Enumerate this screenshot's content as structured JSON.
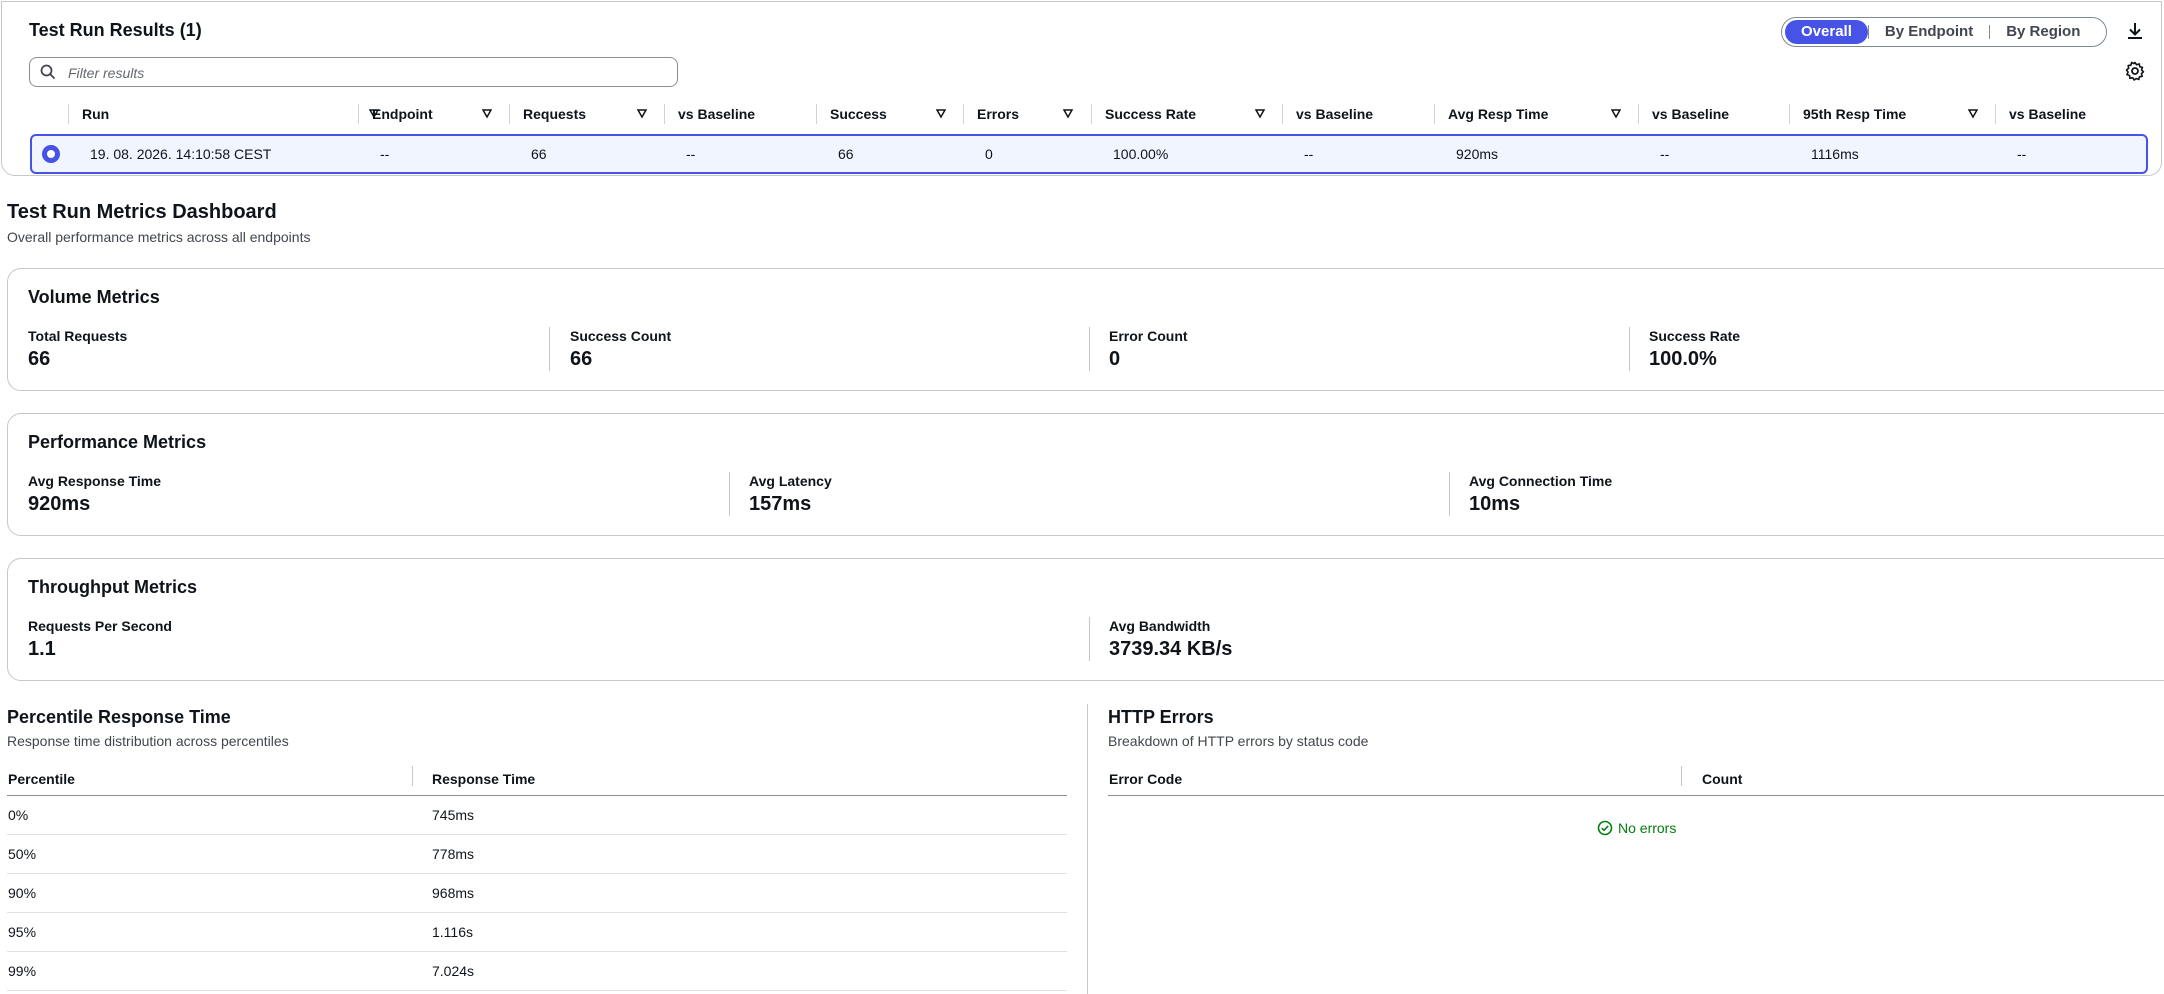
{
  "results": {
    "title": "Test Run Results (1)",
    "filter_placeholder": "Filter results",
    "tabs": [
      {
        "label": "Overall",
        "active": true
      },
      {
        "label": "By Endpoint",
        "active": false
      },
      {
        "label": "By Region",
        "active": false
      }
    ],
    "columns": [
      "Run",
      "Endpoint",
      "Requests",
      "vs Baseline",
      "Success",
      "Errors",
      "Success Rate",
      "vs Baseline",
      "Avg Resp Time",
      "vs Baseline",
      "95th Resp Time",
      "vs Baseline"
    ],
    "row": [
      "19. 08. 2026. 14:10:58 CEST",
      "--",
      "66",
      "--",
      "66",
      "0",
      "100.00%",
      "--",
      "920ms",
      "--",
      "1116ms",
      "--"
    ]
  },
  "dashboard": {
    "title": "Test Run Metrics Dashboard",
    "subtitle": "Overall performance metrics across all endpoints"
  },
  "volume": {
    "title": "Volume Metrics",
    "metrics": [
      {
        "label": "Total Requests",
        "value": "66"
      },
      {
        "label": "Success Count",
        "value": "66"
      },
      {
        "label": "Error Count",
        "value": "0"
      },
      {
        "label": "Success Rate",
        "value": "100.0%"
      }
    ]
  },
  "performance": {
    "title": "Performance Metrics",
    "metrics": [
      {
        "label": "Avg Response Time",
        "value": "920ms"
      },
      {
        "label": "Avg Latency",
        "value": "157ms"
      },
      {
        "label": "Avg Connection Time",
        "value": "10ms"
      }
    ]
  },
  "throughput": {
    "title": "Throughput Metrics",
    "metrics": [
      {
        "label": "Requests Per Second",
        "value": "1.1"
      },
      {
        "label": "Avg Bandwidth",
        "value": "3739.34 KB/s"
      }
    ]
  },
  "percentile": {
    "title": "Percentile Response Time",
    "subtitle": "Response time distribution across percentiles",
    "headers": [
      "Percentile",
      "Response Time"
    ],
    "rows": [
      [
        "0%",
        "745ms"
      ],
      [
        "50%",
        "778ms"
      ],
      [
        "90%",
        "968ms"
      ],
      [
        "95%",
        "1.116s"
      ],
      [
        "99%",
        "7.024s"
      ]
    ]
  },
  "http_errors": {
    "title": "HTTP Errors",
    "subtitle": "Breakdown of HTTP errors by status code",
    "headers": [
      "Error Code",
      "Count"
    ],
    "empty_text": "No errors"
  },
  "colors": {
    "accent": "#4752e6",
    "success": "#037f0c"
  }
}
